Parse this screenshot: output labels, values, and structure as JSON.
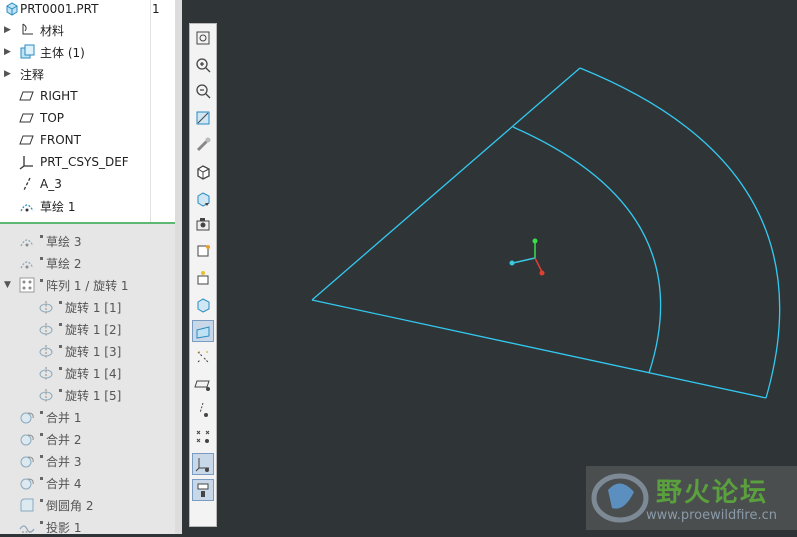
{
  "model_tree": {
    "header": {
      "file": "PRT0001.PRT",
      "column_value": "1"
    },
    "active_items": [
      {
        "label": "材料",
        "icon": "material-icon",
        "expand": true
      },
      {
        "label": "主体 (1)",
        "icon": "body-icon",
        "expand": true
      },
      {
        "label": "注释",
        "icon": "",
        "expand": true
      },
      {
        "label": "RIGHT",
        "icon": "datum-plane-icon",
        "expand": false
      },
      {
        "label": "TOP",
        "icon": "datum-plane-icon",
        "expand": false
      },
      {
        "label": "FRONT",
        "icon": "datum-plane-icon",
        "expand": false
      },
      {
        "label": "PRT_CSYS_DEF",
        "icon": "csys-icon",
        "expand": false
      },
      {
        "label": "A_3",
        "icon": "datum-axis-icon",
        "expand": false
      },
      {
        "label": "草绘 1",
        "icon": "sketch-icon",
        "expand": false
      }
    ],
    "suppressed_items": [
      {
        "label": "草绘 3",
        "icon": "sketch-icon"
      },
      {
        "label": "草绘 2",
        "icon": "sketch-icon"
      },
      {
        "label": "阵列 1 / 旋转 1",
        "icon": "pattern-icon"
      },
      {
        "label": "旋转 1 [1]",
        "icon": "revolve-icon"
      },
      {
        "label": "旋转 1 [2]",
        "icon": "revolve-icon"
      },
      {
        "label": "旋转 1 [3]",
        "icon": "revolve-icon"
      },
      {
        "label": "旋转 1 [4]",
        "icon": "revolve-icon"
      },
      {
        "label": "旋转 1 [5]",
        "icon": "revolve-icon"
      },
      {
        "label": "合并 1",
        "icon": "merge-icon"
      },
      {
        "label": "合并 2",
        "icon": "merge-icon"
      },
      {
        "label": "合并 3",
        "icon": "merge-icon"
      },
      {
        "label": "合并 4",
        "icon": "merge-icon"
      },
      {
        "label": "倒圆角 2",
        "icon": "round-icon"
      },
      {
        "label": "投影 1",
        "icon": "projection-icon"
      }
    ]
  },
  "view_toolbar": [
    "refit-icon",
    "zoom-in-icon",
    "zoom-out-icon",
    "repaint-icon",
    "perspective-icon",
    "display-style-icon",
    "saved-views-icon",
    "view-manager-icon",
    "appearance-icon",
    "section-icon",
    "spin-center-icon",
    "annotation-display-icon",
    "plane-display-icon",
    "axis-display-icon",
    "point-display-icon",
    "csys-display-icon",
    "filter-icon",
    "sketch-view-icon"
  ],
  "colors": {
    "viewport_bg": "#2f3436",
    "geometry": "#33c8f0",
    "tree_separator": "#5fb872"
  },
  "watermark": {
    "title": "野火论坛",
    "url": "www.proewildfire.cn"
  }
}
